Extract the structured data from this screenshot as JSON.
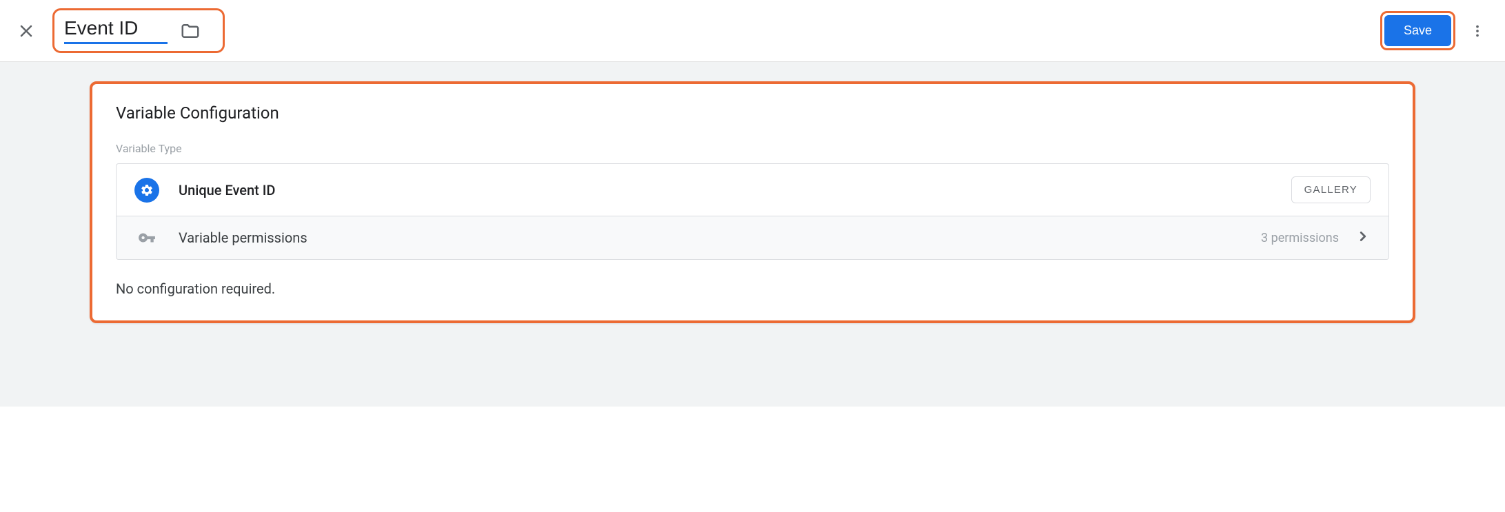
{
  "header": {
    "title_value": "Event ID",
    "save_label": "Save"
  },
  "panel": {
    "title": "Variable Configuration",
    "type_label": "Variable Type",
    "variable_type_name": "Unique Event ID",
    "gallery_label": "GALLERY",
    "permissions_label": "Variable permissions",
    "permissions_count": "3 permissions",
    "no_config_text": "No configuration required."
  }
}
